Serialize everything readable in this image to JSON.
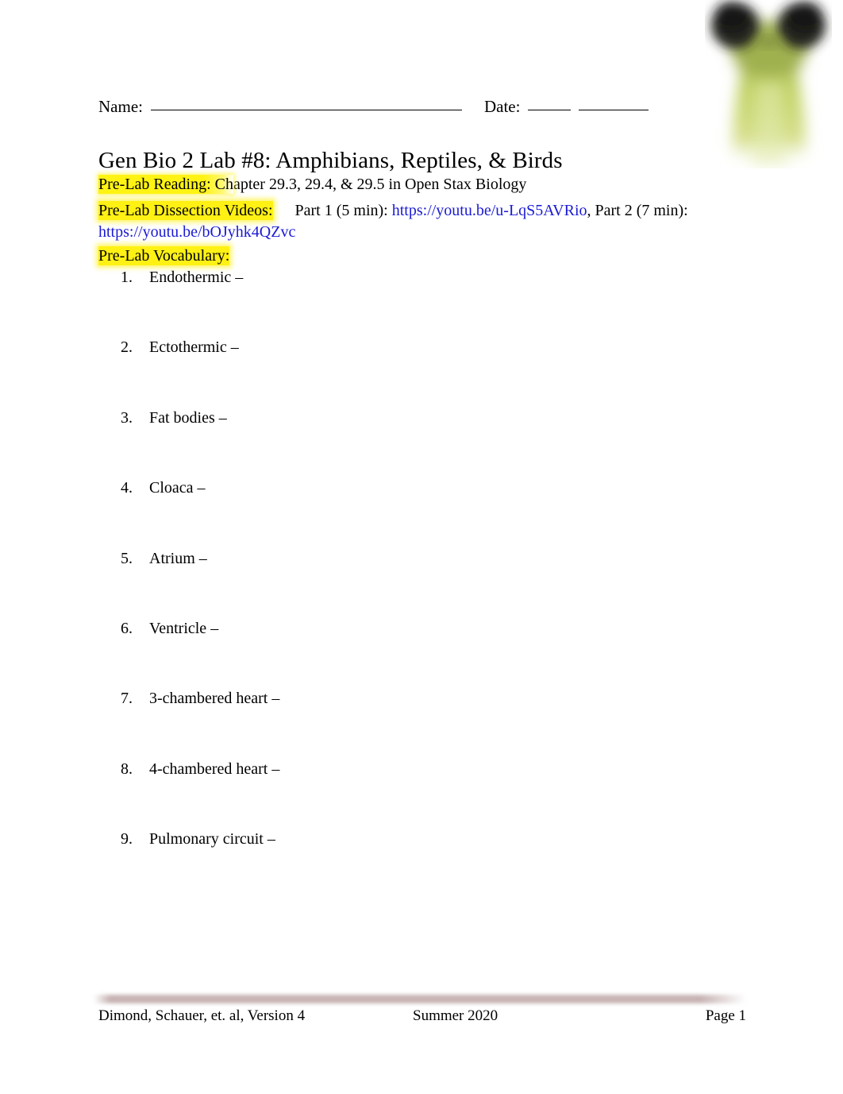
{
  "header": {
    "name_label": "Name:",
    "date_label": "Date:"
  },
  "title": "Gen Bio 2 Lab #8: Amphibians, Reptiles, & Birds",
  "prelab": {
    "reading_label": "Pre-Lab Reading: Ch",
    "reading_rest": "apter 29.3, 29.4, & 29.5 in Open Stax Biology",
    "videos_label": "Pre-Lab Dissection Videos:",
    "videos_part1_label": "Part 1 (5 min):",
    "videos_part1_url": "https://youtu.be/u-LqS5AVRio",
    "videos_separator": ", ",
    "videos_part2_label": "Part 2 (7 min):",
    "videos_part2_url": "https://youtu.be/bOJyhk4QZvc",
    "vocabulary_label": "Pre-Lab Vocabulary:"
  },
  "vocabulary": [
    {
      "num": "1.",
      "term": "Endothermic –"
    },
    {
      "num": "2.",
      "term": "Ectothermic –"
    },
    {
      "num": "3.",
      "term": "Fat bodies –"
    },
    {
      "num": "4.",
      "term": "Cloaca –"
    },
    {
      "num": "5.",
      "term": "Atrium –"
    },
    {
      "num": "6.",
      "term": "Ventricle –"
    },
    {
      "num": "7.",
      "term": "3-chambered heart –"
    },
    {
      "num": "8.",
      "term": "4-chambered heart –"
    },
    {
      "num": "9.",
      "term": "Pulmonary circuit –"
    }
  ],
  "footer": {
    "left": "Dimond, Schauer, et. al, Version 4",
    "center": "Summer 2020",
    "right": "Page 1"
  },
  "colors": {
    "link": "#1a1ad4",
    "highlight": "#fff000",
    "footer_rule": "#bea6a6",
    "frog_body": "#b9cc5a",
    "frog_eye": "#2b2b24"
  }
}
